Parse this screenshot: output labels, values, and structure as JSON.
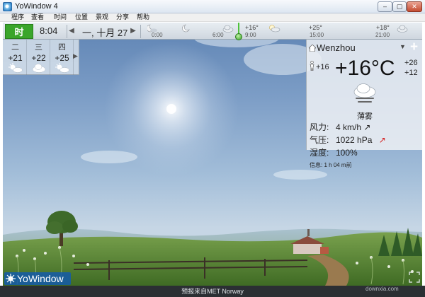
{
  "window": {
    "title": "YoWindow 4",
    "min_label": "–",
    "max_label": "▢",
    "close_label": "✕"
  },
  "menu": [
    "程序",
    "查看",
    "时间",
    "位置",
    "景观",
    "分享",
    "帮助"
  ],
  "topbar": {
    "now_label": "时",
    "clock": "8:04",
    "date": "一, 十月 27",
    "prev_arrow": "◀",
    "next_arrow": "▶"
  },
  "timeline": {
    "times": [
      "0:00",
      "6:00",
      "9:00",
      "15:00",
      "21:00"
    ],
    "temps": [
      "+16°",
      "+25°",
      "+18°"
    ],
    "current_marker_time": "9:00"
  },
  "forecast": {
    "days": [
      {
        "name": "二",
        "temp": "+21",
        "icon": "sun-cloud-icon"
      },
      {
        "name": "三",
        "temp": "+22",
        "icon": "cloud-icon"
      },
      {
        "name": "四",
        "temp": "+25",
        "icon": "sun-cloud-icon"
      }
    ],
    "more_arrow": "▶"
  },
  "current": {
    "city": "Wenzhou",
    "temperature": "+16°C",
    "feels_like": "+16",
    "high": "+26",
    "low": "+12",
    "condition": "薄雾",
    "wind_label": "风力:",
    "wind_value": "4 km/h ↗",
    "pressure_label": "气压:",
    "pressure_value": "1022 hPa",
    "pressure_trend": "↗",
    "humidity_label": "湿度:",
    "humidity_value": "100%",
    "info_label": "信息:",
    "info_value": "1 h 04 m前",
    "dropdown_arrow": "▼",
    "add_label": "+"
  },
  "branding": {
    "logo_text": "YoWindow"
  },
  "status": {
    "text": "预报来自MET Norway",
    "watermark": "downxia.com"
  },
  "colors": {
    "now_button": "#3aa52a",
    "sky_top": "#5f84b4",
    "grass": "#4f7c2e",
    "logo_bg": "#145aaa"
  }
}
